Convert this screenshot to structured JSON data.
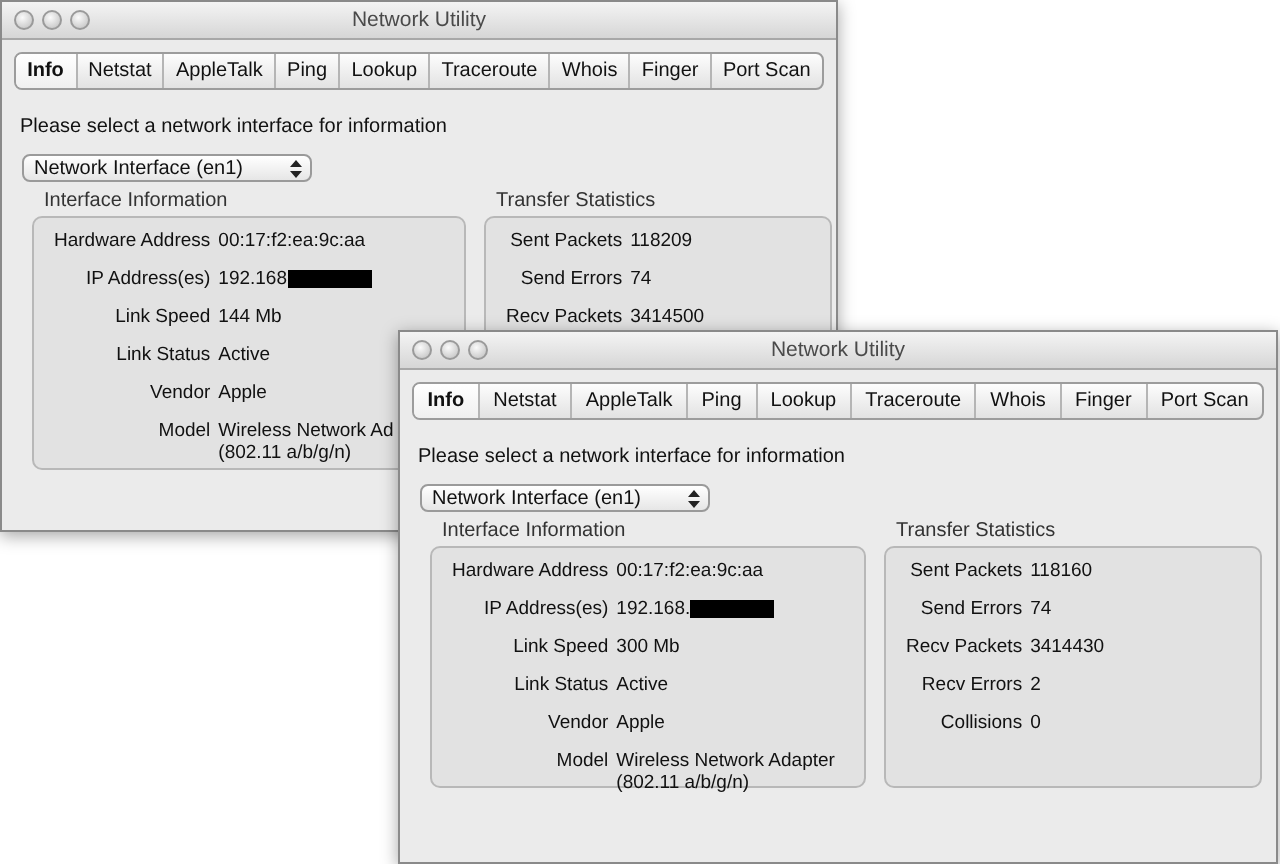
{
  "windows": [
    {
      "title": "Network Utility",
      "tabs": [
        {
          "label": "Info",
          "selected": true
        },
        {
          "label": "Netstat",
          "selected": false
        },
        {
          "label": "AppleTalk",
          "selected": false
        },
        {
          "label": "Ping",
          "selected": false
        },
        {
          "label": "Lookup",
          "selected": false
        },
        {
          "label": "Traceroute",
          "selected": false
        },
        {
          "label": "Whois",
          "selected": false
        },
        {
          "label": "Finger",
          "selected": false
        },
        {
          "label": "Port Scan",
          "selected": false
        }
      ],
      "prompt": "Please select a network interface for information",
      "interface_popup": "Network Interface (en1)",
      "interface_group": {
        "title": "Interface Information",
        "rows": [
          {
            "label": "Hardware Address",
            "value": "00:17:f2:ea:9c:aa",
            "redacted": false
          },
          {
            "label": "IP Address(es)",
            "value": "192.168",
            "redacted": true
          },
          {
            "label": "Link Speed",
            "value": "144 Mb",
            "redacted": false
          },
          {
            "label": "Link Status",
            "value": "Active",
            "redacted": false
          },
          {
            "label": "Vendor",
            "value": "Apple",
            "redacted": false
          },
          {
            "label": "Model",
            "value": "Wireless Network Ad",
            "continuation": "(802.11 a/b/g/n)",
            "redacted": false
          }
        ]
      },
      "transfer_group": {
        "title": "Transfer Statistics",
        "rows": [
          {
            "label": "Sent Packets",
            "value": "118209"
          },
          {
            "label": "Send Errors",
            "value": "74"
          },
          {
            "label": "Recv Packets",
            "value": "3414500"
          }
        ]
      }
    },
    {
      "title": "Network Utility",
      "tabs": [
        {
          "label": "Info",
          "selected": true
        },
        {
          "label": "Netstat",
          "selected": false
        },
        {
          "label": "AppleTalk",
          "selected": false
        },
        {
          "label": "Ping",
          "selected": false
        },
        {
          "label": "Lookup",
          "selected": false
        },
        {
          "label": "Traceroute",
          "selected": false
        },
        {
          "label": "Whois",
          "selected": false
        },
        {
          "label": "Finger",
          "selected": false
        },
        {
          "label": "Port Scan",
          "selected": false
        }
      ],
      "prompt": "Please select a network interface for information",
      "interface_popup": "Network Interface (en1)",
      "interface_group": {
        "title": "Interface Information",
        "rows": [
          {
            "label": "Hardware Address",
            "value": "00:17:f2:ea:9c:aa",
            "redacted": false
          },
          {
            "label": "IP Address(es)",
            "value": "192.168.",
            "redacted": true
          },
          {
            "label": "Link Speed",
            "value": "300 Mb",
            "redacted": false
          },
          {
            "label": "Link Status",
            "value": "Active",
            "redacted": false
          },
          {
            "label": "Vendor",
            "value": "Apple",
            "redacted": false
          },
          {
            "label": "Model",
            "value": "Wireless Network Adapter",
            "continuation": "(802.11 a/b/g/n)",
            "redacted": false
          }
        ]
      },
      "transfer_group": {
        "title": "Transfer Statistics",
        "rows": [
          {
            "label": "Sent Packets",
            "value": "118160"
          },
          {
            "label": "Send Errors",
            "value": "74"
          },
          {
            "label": "Recv Packets",
            "value": "3414430"
          },
          {
            "label": "Recv Errors",
            "value": "2"
          },
          {
            "label": "Collisions",
            "value": "0"
          }
        ]
      }
    }
  ]
}
